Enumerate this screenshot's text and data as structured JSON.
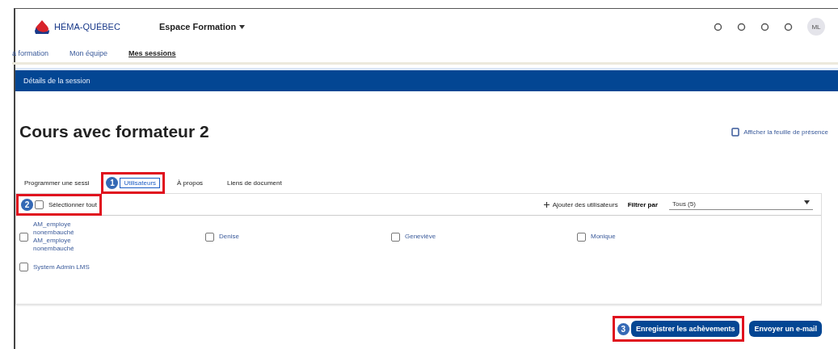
{
  "header": {
    "logo_text": "HÉMA-QUÉBEC",
    "app_menu": "Espace Formation",
    "avatar": "ML"
  },
  "nav": [
    {
      "label": "a formation",
      "selected": false
    },
    {
      "label": "Mon équipe",
      "selected": false
    },
    {
      "label": "Mes sessions",
      "selected": true
    }
  ],
  "banner": {
    "title": "Détails de la session"
  },
  "page": {
    "title": "Cours avec formateur 2",
    "attendance_link": "Afficher la feuille de présence"
  },
  "tabs": [
    {
      "label": "Programmer une sessi",
      "selected": false,
      "highlighted": false
    },
    {
      "label": "Utilisateurs",
      "selected": true,
      "highlighted": true,
      "badge": "1"
    },
    {
      "label": "À propos",
      "selected": false,
      "highlighted": false
    },
    {
      "label": "Liens de document",
      "selected": false,
      "highlighted": false
    }
  ],
  "toolbar": {
    "select_all": {
      "label": "Sélectionner tout",
      "checked": false,
      "highlighted": true,
      "badge": "2"
    },
    "add_users": "Ajouter des utilisateurs",
    "filter_label": "Filtrer par",
    "filter_value": "Tous (5)"
  },
  "users": [
    {
      "name": "AM_employe nonembauché AM_employe nonembauché",
      "checked": false
    },
    {
      "name": "Denise",
      "checked": false
    },
    {
      "name": "Geneviève",
      "checked": false
    },
    {
      "name": "Monique",
      "checked": false
    },
    {
      "name": "System Admin LMS",
      "checked": false
    }
  ],
  "buttons": [
    {
      "label": "Enregistrer les achèvements",
      "highlighted": true,
      "badge": "3"
    },
    {
      "label": "Envoyer un e-mail",
      "highlighted": false
    }
  ]
}
